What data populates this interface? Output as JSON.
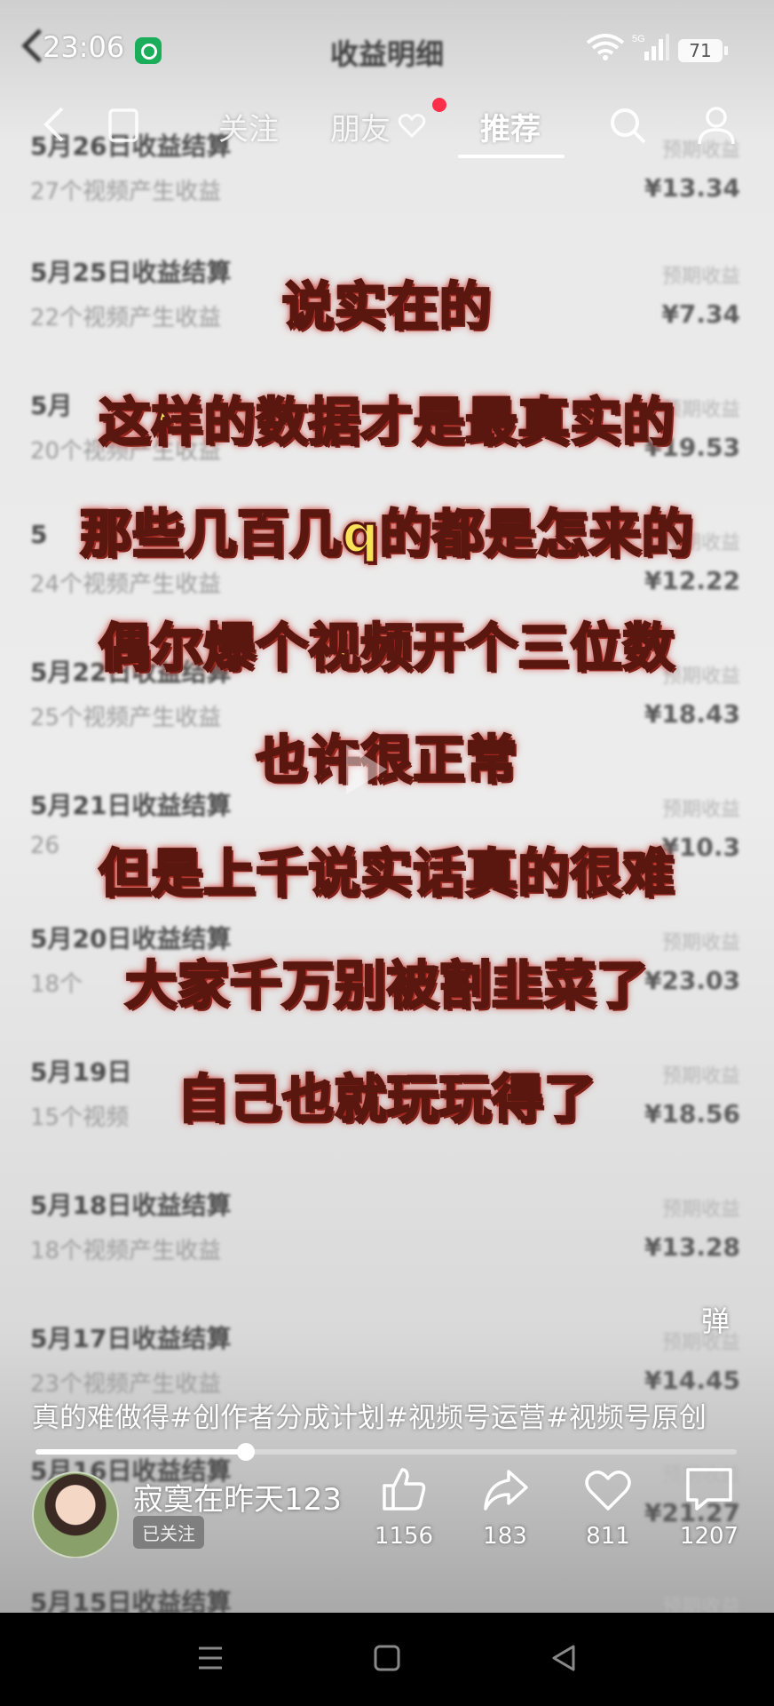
{
  "status_bar": {
    "time": "23:06",
    "network": "5G",
    "battery": "71"
  },
  "background_page": {
    "title": "收益明细",
    "rows": [
      {
        "title": "5月26日收益结算",
        "subtitle": "27个视频产生收益",
        "label": "预期收益",
        "amount": "¥13.34"
      },
      {
        "title": "5月25日收益结算",
        "subtitle": "22个视频产生收益",
        "label": "预期收益",
        "amount": "¥7.34"
      },
      {
        "title": "5月",
        "subtitle": "20个视频产生收益",
        "label": "预期收益",
        "amount": "¥19.53"
      },
      {
        "title": "5",
        "subtitle": "24个视频产生收益",
        "label": "预期收益",
        "amount": "¥12.22"
      },
      {
        "title": "5月22日收益结算",
        "subtitle": "25个视频产生收益",
        "label": "预期收益",
        "amount": "¥18.43"
      },
      {
        "title": "5月21日收益结算",
        "subtitle": "26",
        "label": "预期收益",
        "amount": "¥10.3"
      },
      {
        "title": "5月20日收益结算",
        "subtitle": "18个",
        "label": "预期收益",
        "amount": "¥23.03"
      },
      {
        "title": "5月19日",
        "subtitle": "15个视频",
        "label": "预期收益",
        "amount": "¥18.56"
      },
      {
        "title": "5月18日收益结算",
        "subtitle": "18个视频产生收益",
        "label": "预期收益",
        "amount": "¥13.28"
      },
      {
        "title": "5月17日收益结算",
        "subtitle": "23个视频产生收益",
        "label": "预期收益",
        "amount": "¥14.45"
      },
      {
        "title": "5月16日收益结算",
        "subtitle": "",
        "label": "预期收益",
        "amount": "¥21.27"
      },
      {
        "title": "5月15日收益结算",
        "subtitle": "",
        "label": "预期收益",
        "amount": ""
      }
    ]
  },
  "top_nav": {
    "tabs": [
      {
        "label": "关注"
      },
      {
        "label": "朋友"
      },
      {
        "label": "推荐"
      }
    ]
  },
  "captions": [
    "说实在的",
    "这样的数据才是最真实的",
    "那些几百几q的都是怎来的",
    "偶尔爆个视频开个三位数",
    "也许很正常",
    "但是上千说实话真的很难",
    "大家千万别被割韭菜了",
    "自己也就玩玩得了"
  ],
  "danmu_label": "弹",
  "description": "真的难做得#创作者分成计划#视频号运营#视频号原创",
  "progress": 0.3,
  "author": {
    "name": "寂寞在昨天123",
    "follow_status": "已关注"
  },
  "actions": {
    "likes": "1156",
    "shares": "183",
    "favorites": "811",
    "comments": "1207"
  }
}
